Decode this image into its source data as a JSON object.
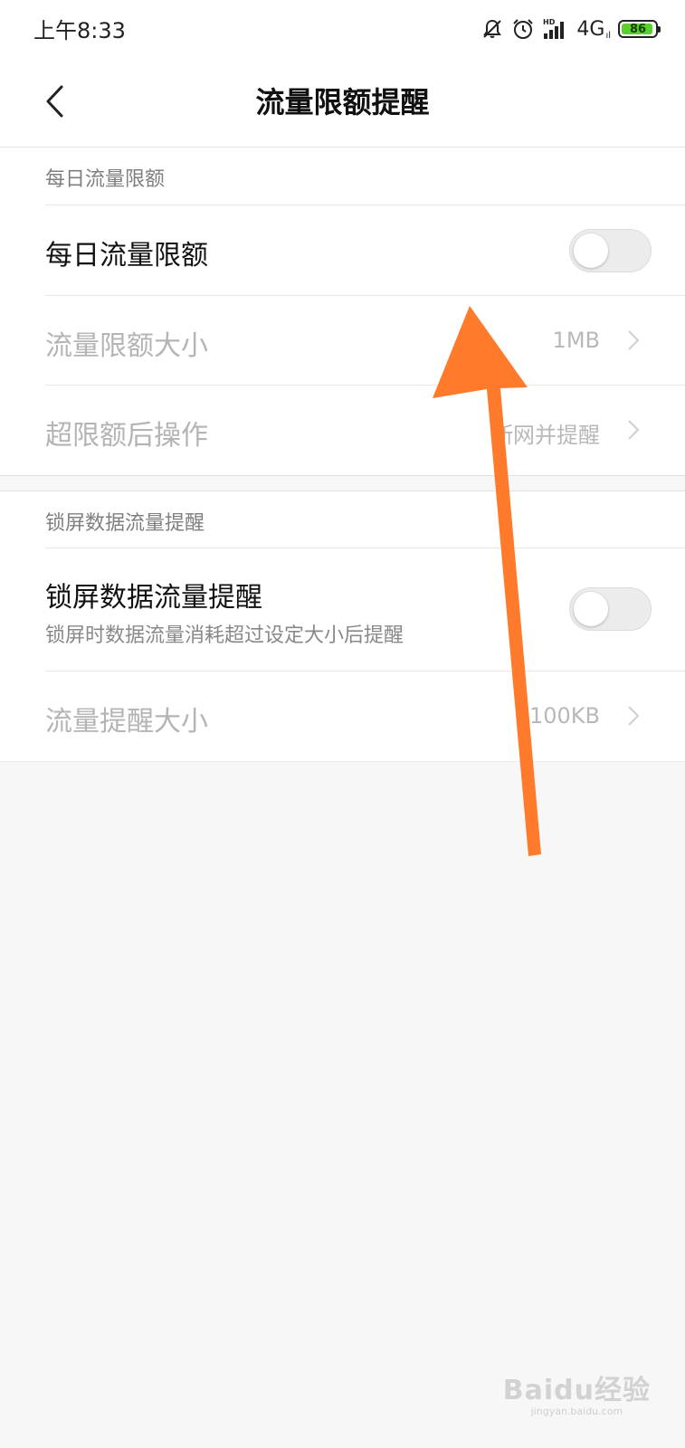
{
  "status_bar": {
    "time": "上午8:33",
    "network": "4G",
    "network_sub": "ıl",
    "battery": "86",
    "hd_label": "HD",
    "icons": [
      "mute-icon",
      "alarm-icon",
      "signal-icon"
    ]
  },
  "header": {
    "title": "流量限额提醒"
  },
  "daily": {
    "section_title": "每日流量限额",
    "toggle_label": "每日流量限额",
    "toggle_on": false,
    "limit_label": "流量限额大小",
    "limit_value": "1MB",
    "action_label": "超限额后操作",
    "action_value": "断网并提醒"
  },
  "lockscreen": {
    "section_title": "锁屏数据流量提醒",
    "toggle_label": "锁屏数据流量提醒",
    "toggle_desc": "锁屏时数据流量消耗超过设定大小后提醒",
    "toggle_on": false,
    "size_label": "流量提醒大小",
    "size_value": "100KB"
  },
  "overlay": {
    "arrow_color": "#ff7a2b"
  },
  "watermark": {
    "brand": "Baidu经验",
    "url": "jingyan.baidu.com"
  }
}
